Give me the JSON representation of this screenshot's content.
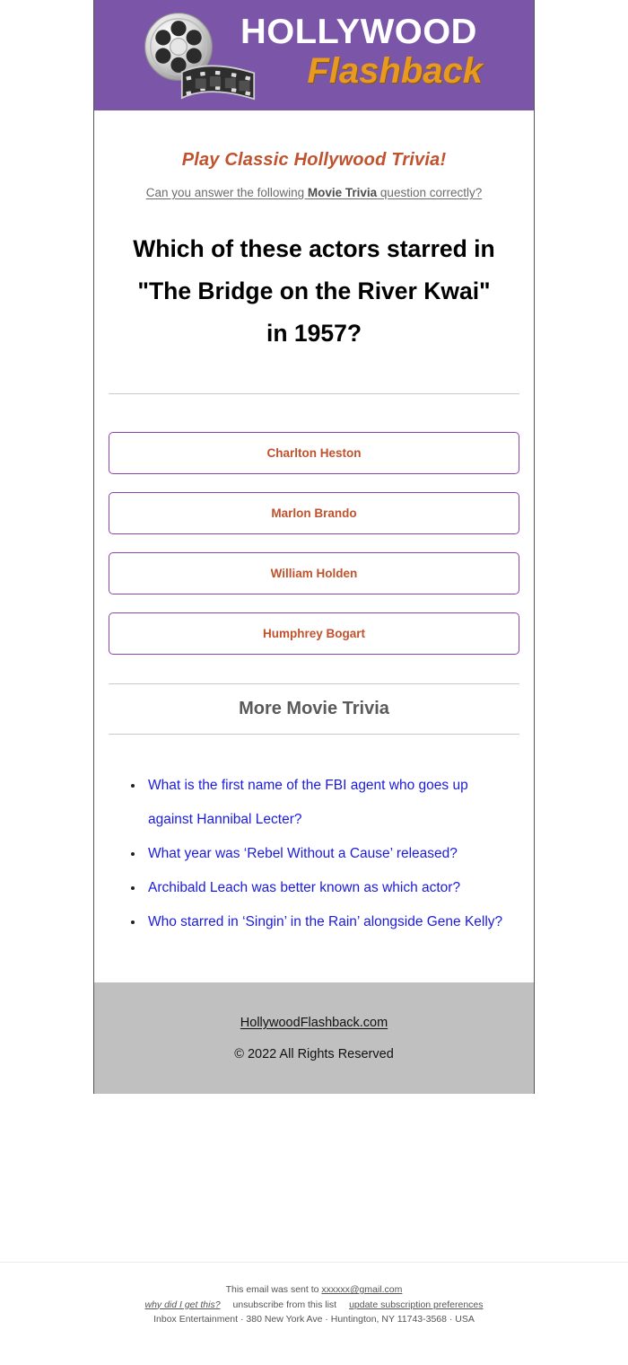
{
  "header": {
    "logo_line1": "HOLLYWOOD",
    "logo_line2": "Flashback",
    "reel_icon": "film-reel-icon",
    "filmstrip_icon": "film-strip-icon",
    "background_color": "#7b55a8",
    "logo_line1_color": "#ffffff",
    "logo_line2_color": "#e8991f"
  },
  "intro": {
    "headline": "Play Classic Hollywood Trivia!",
    "headline_color": "#c0522d",
    "subhead_prefix": "Can you answer the following ",
    "subhead_bold": "Movie Trivia",
    "subhead_suffix": " question correctly?"
  },
  "quiz": {
    "question": "Which of these actors starred in \"The Bridge on the River Kwai\" in 1957?",
    "answers": [
      {
        "label": "Charlton Heston"
      },
      {
        "label": "Marlon Brando"
      },
      {
        "label": "William Holden"
      },
      {
        "label": "Humphrey Bogart"
      }
    ],
    "answer_border_color": "#8e44ad",
    "answer_text_color": "#c0522d"
  },
  "more_trivia": {
    "title": "More Movie Trivia",
    "links": [
      {
        "label": "What is the first name of the FBI agent who goes up against Hannibal Lecter?"
      },
      {
        "label": "What year was ‘Rebel Without a Cause’ released?"
      },
      {
        "label": "Archibald Leach was better known as which actor?"
      },
      {
        "label": "Who starred in ‘Singin’ in the Rain’ alongside Gene Kelly?"
      }
    ],
    "link_color": "#1b1bdd"
  },
  "card_footer": {
    "site_link": "HollywoodFlashback.com",
    "copyright": "© 2022 All Rights Reserved",
    "background_color": "#c0c0c0"
  },
  "legal": {
    "sent_to_prefix": "This email was sent to ",
    "sent_to_email": "xxxxxx@gmail.com",
    "why_link": "why did I get this?",
    "unsubscribe_link": "unsubscribe from this list",
    "preferences_link": "update subscription preferences",
    "address": "Inbox Entertainment · 380 New York Ave · Huntington, NY 11743-3568 · USA"
  }
}
